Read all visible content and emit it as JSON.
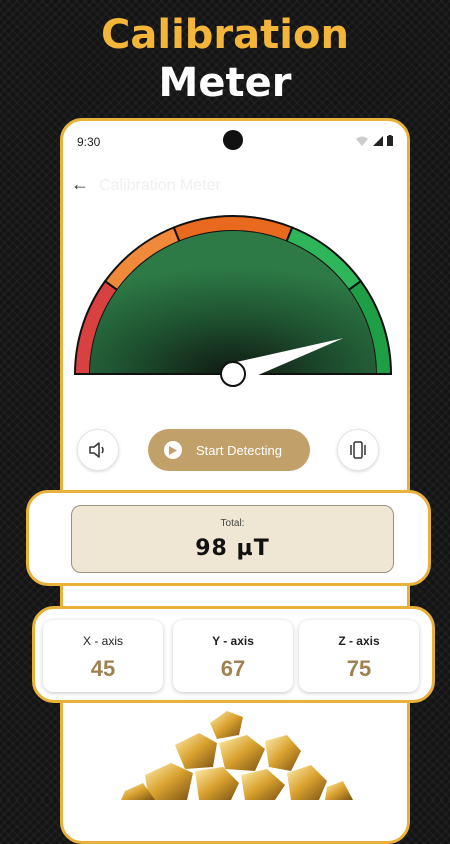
{
  "headline": {
    "line1": "Calibration",
    "line2": "Meter"
  },
  "status_bar": {
    "time": "9:30"
  },
  "app_bar": {
    "title": "Calibration Meter"
  },
  "gauge": {
    "needle_value_fraction": 0.9
  },
  "controls": {
    "detect_label": "Start Detecting"
  },
  "total": {
    "label": "Total:",
    "value": "98 µT"
  },
  "axes": [
    {
      "name": "X - axis",
      "value": "45"
    },
    {
      "name": "Y - axis",
      "value": "67"
    },
    {
      "name": "Z - axis",
      "value": "75"
    }
  ],
  "colors": {
    "accent": "#E8B23A",
    "button": "#C2A06A",
    "axis_value": "#A08152"
  }
}
